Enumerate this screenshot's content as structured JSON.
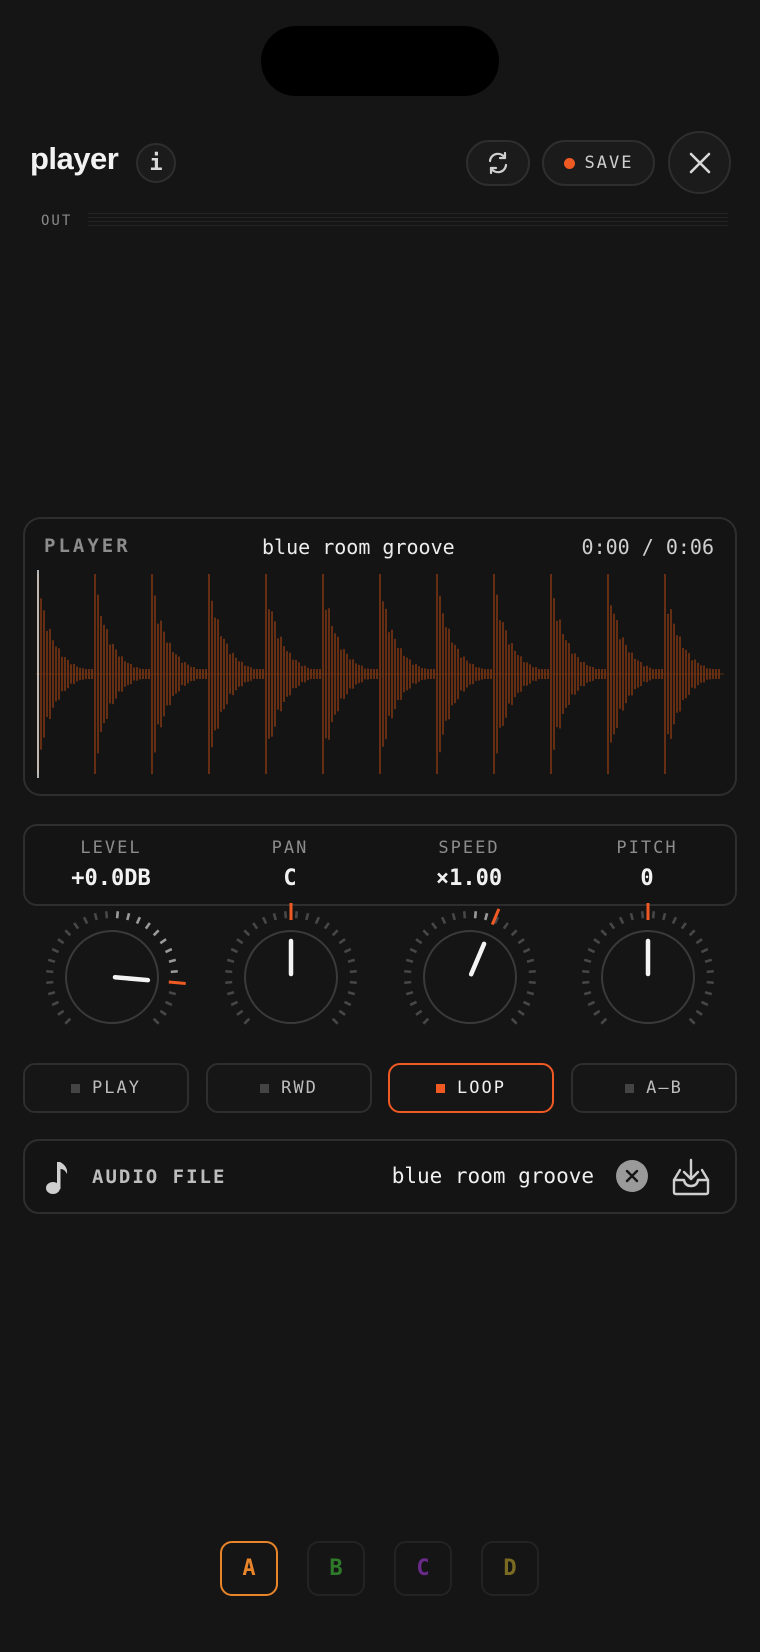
{
  "header": {
    "title": "player",
    "info_label": "i",
    "save_label": "SAVE",
    "out_label": "OUT"
  },
  "player": {
    "label": "PLAYER",
    "track": "blue room groove",
    "time": "0:00 / 0:06",
    "playhead_fraction": 0.0
  },
  "params": [
    {
      "label": "LEVEL",
      "value": "+0.0DB"
    },
    {
      "label": "PAN",
      "value": "C"
    },
    {
      "label": "SPEED",
      "value": "×1.00"
    },
    {
      "label": "PITCH",
      "value": "0"
    }
  ],
  "knobs": [
    {
      "name": "level",
      "angle_deg": 95,
      "marker_deg": 95
    },
    {
      "name": "pan",
      "angle_deg": 0,
      "marker_deg": 0
    },
    {
      "name": "speed",
      "angle_deg": 23,
      "marker_deg": 23
    },
    {
      "name": "pitch",
      "angle_deg": 0,
      "marker_deg": 0
    }
  ],
  "transport": [
    {
      "label": "PLAY",
      "active": false
    },
    {
      "label": "RWD",
      "active": false
    },
    {
      "label": "LOOP",
      "active": true
    },
    {
      "label": "A–B",
      "active": false
    }
  ],
  "file": {
    "label": "AUDIO FILE",
    "name": "blue room groove"
  },
  "slots": [
    {
      "label": "A",
      "color": "#e8852a",
      "active": true
    },
    {
      "label": "B",
      "color": "#2f7a2a",
      "active": false
    },
    {
      "label": "C",
      "color": "#6a2a8a",
      "active": false
    },
    {
      "label": "D",
      "color": "#7a6a22",
      "active": false
    }
  ],
  "colors": {
    "accent": "#ef5a24",
    "waveform": "#7a3412",
    "background": "#151515"
  }
}
